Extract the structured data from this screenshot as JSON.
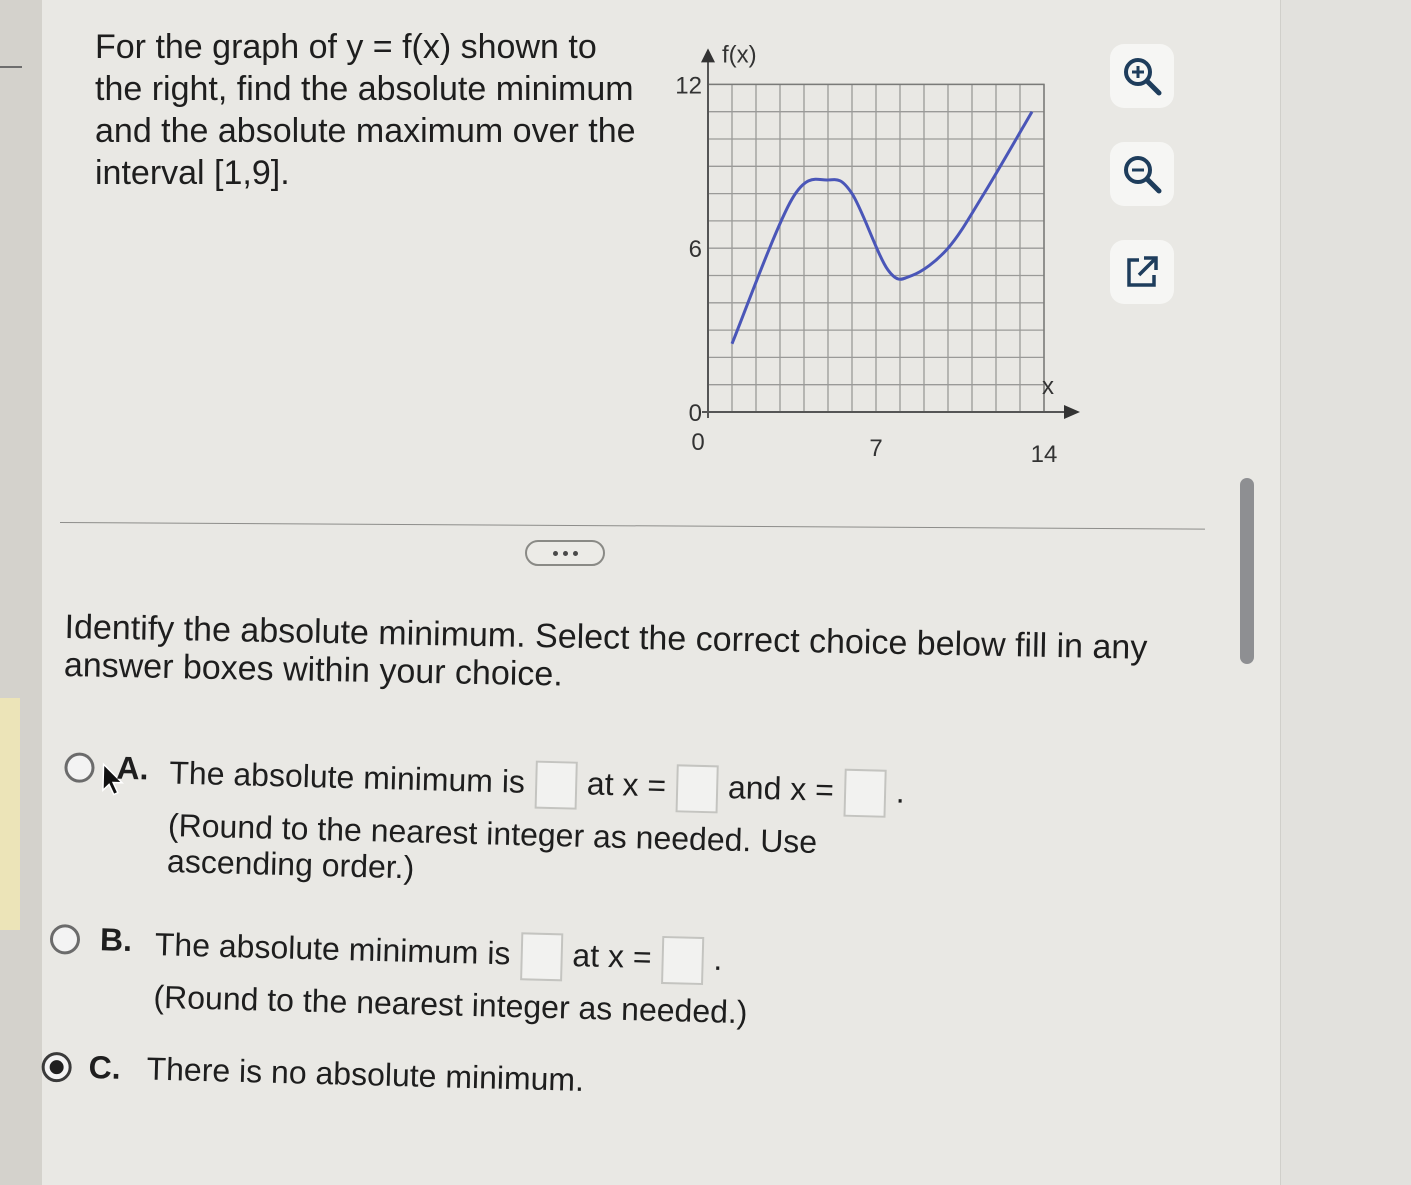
{
  "problem": {
    "line1": "For the graph of y = f(x) shown to",
    "line2": "the right, find the absolute minimum",
    "line3": "and the absolute maximum over the",
    "line4": "interval [1,9]."
  },
  "graph": {
    "y_axis_label": "f(x)",
    "x_axis_label": "x",
    "y_tick_labels": [
      "12",
      "6",
      "0"
    ],
    "x_tick_labels": [
      "0",
      "7",
      "14"
    ],
    "x_range": [
      0,
      14
    ],
    "y_range": [
      0,
      12
    ],
    "curve_points": [
      [
        1,
        2.5
      ],
      [
        3.5,
        7.8
      ],
      [
        5,
        8.5
      ],
      [
        6,
        8
      ],
      [
        7.5,
        5.2
      ],
      [
        8.5,
        5
      ],
      [
        10,
        6
      ],
      [
        11.5,
        8
      ],
      [
        13.5,
        11
      ]
    ],
    "curve_color": "#4a56b8",
    "grid": true
  },
  "tools": {
    "zoom_in_icon": "zoom-in-icon",
    "zoom_out_icon": "zoom-out-icon",
    "popout_icon": "external-link-icon"
  },
  "question": {
    "text": "Identify the absolute minimum. Select the correct choice below fill in any answer boxes within your choice."
  },
  "choices": [
    {
      "letter": "A.",
      "part1": "The absolute minimum is",
      "part2": "at x =",
      "part3": "and x =",
      "end": ".",
      "note_line1": "(Round to the nearest integer as needed. Use",
      "note_line2": "ascending order.)",
      "selected": false
    },
    {
      "letter": "B.",
      "part1": "The absolute minimum is",
      "part2": "at x =",
      "end": ".",
      "note_line1": "(Round to the nearest integer as needed.)",
      "selected": false
    },
    {
      "letter": "C.",
      "part1": "There is no absolute minimum.",
      "selected": true
    }
  ]
}
